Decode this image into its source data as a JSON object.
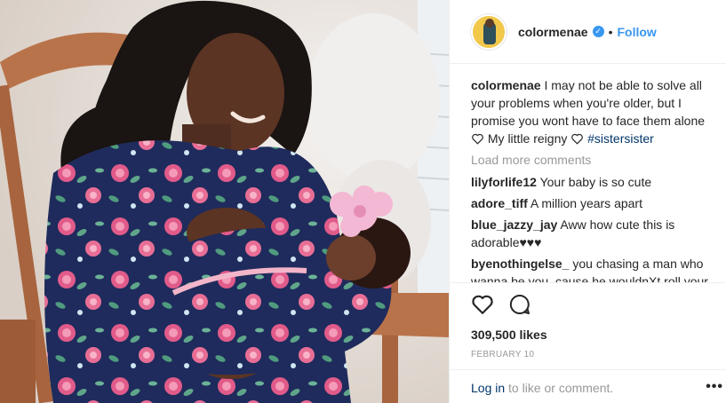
{
  "post": {
    "username": "colormenae",
    "verified_mark": "✓",
    "separator": "•",
    "follow_label": "Follow",
    "caption_text_1": "I may not be able to solve all your problems when you're older, but I promise you wont have to face them alone",
    "caption_text_2": "My little reigny",
    "hashtag": "#sistersister",
    "load_more": "Load more comments",
    "comments": [
      {
        "user": "lilyforlife12",
        "text": "Your baby is so cute"
      },
      {
        "user": "adore_tiff",
        "text": "A million years apart"
      },
      {
        "user": "blue_jazzy_jay",
        "text": "Aww how cute this is adorable♥♥♥"
      },
      {
        "user": "byenothingelse_",
        "text": "you chasing a man who wanna be you. cause he wouldnXt roll your"
      }
    ],
    "likes": "309,500 likes",
    "date": "FEBRUARY 10",
    "login_link": "Log in",
    "login_suffix": " to like or comment.",
    "more_options": "•••"
  },
  "icons": {
    "like": "heart-outline-icon",
    "comment": "speech-bubble-icon",
    "caption_hearts": "heart-outline-icon",
    "more": "ellipsis-icon"
  },
  "colors": {
    "link_blue": "#3897f0",
    "hashtag_navy": "#003569",
    "muted_gray": "#999999",
    "dress_navy": "#1f2b5c",
    "flower_pink": "#e15b8a",
    "avatar_yellow": "#f2c84b"
  }
}
